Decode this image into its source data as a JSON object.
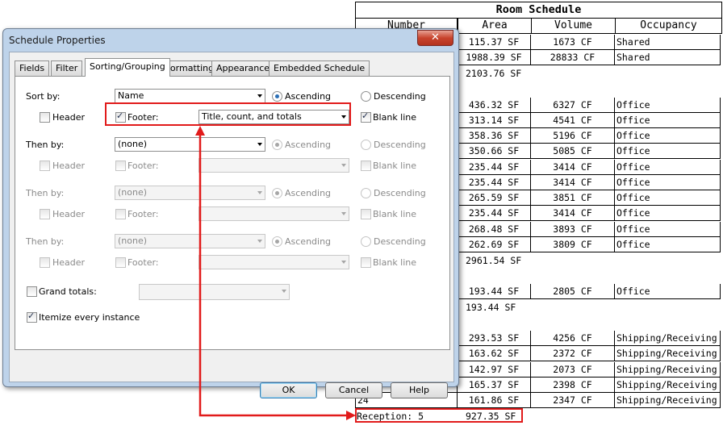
{
  "schedule": {
    "title": "Room Schedule",
    "headers": [
      "Number",
      "Area",
      "Volume",
      "Occupancy"
    ],
    "rows": [
      {
        "number": "",
        "area": "115.37 SF",
        "volume": "1673 CF",
        "occupancy": "Shared"
      },
      {
        "number": "",
        "area": "1988.39 SF",
        "volume": "28833 CF",
        "occupancy": "Shared"
      },
      {
        "number": "",
        "area": "436.32 SF",
        "volume": "6327 CF",
        "occupancy": "Office"
      },
      {
        "number": "",
        "area": "313.14 SF",
        "volume": "4541 CF",
        "occupancy": "Office"
      },
      {
        "number": "",
        "area": "358.36 SF",
        "volume": "5196 CF",
        "occupancy": "Office"
      },
      {
        "number": "",
        "area": "350.66 SF",
        "volume": "5085 CF",
        "occupancy": "Office"
      },
      {
        "number": "",
        "area": "235.44 SF",
        "volume": "3414 CF",
        "occupancy": "Office"
      },
      {
        "number": "",
        "area": "235.44 SF",
        "volume": "3414 CF",
        "occupancy": "Office"
      },
      {
        "number": "",
        "area": "265.59 SF",
        "volume": "3851 CF",
        "occupancy": "Office"
      },
      {
        "number": "",
        "area": "235.44 SF",
        "volume": "3414 CF",
        "occupancy": "Office"
      },
      {
        "number": "",
        "area": "268.48 SF",
        "volume": "3893 CF",
        "occupancy": "Office"
      },
      {
        "number": "",
        "area": "262.69 SF",
        "volume": "3809 CF",
        "occupancy": "Office"
      },
      {
        "number": "",
        "area": "193.44 SF",
        "volume": "2805 CF",
        "occupancy": "Office"
      },
      {
        "number": "",
        "area": "293.53 SF",
        "volume": "4256 CF",
        "occupancy": "Shipping/Receiving"
      },
      {
        "number": "",
        "area": "163.62 SF",
        "volume": "2372 CF",
        "occupancy": "Shipping/Receiving"
      },
      {
        "number": "",
        "area": "142.97 SF",
        "volume": "2073 CF",
        "occupancy": "Shipping/Receiving"
      },
      {
        "number": "",
        "area": "165.37 SF",
        "volume": "2398 CF",
        "occupancy": "Shipping/Receiving"
      },
      {
        "number": "24",
        "area": "161.86 SF",
        "volume": "2347 CF",
        "occupancy": "Shipping/Receiving"
      }
    ],
    "subtotals": [
      {
        "label": "",
        "area": "2103.76 SF"
      },
      {
        "label": "",
        "area": "2961.54 SF"
      },
      {
        "label": "",
        "area": "193.44 SF"
      },
      {
        "label": "Reception: 5",
        "area": "927.35 SF"
      }
    ]
  },
  "dialog": {
    "title": "Schedule Properties",
    "close_glyph": "✕",
    "tabs": [
      "Fields",
      "Filter",
      "Sorting/Grouping",
      "Formatting",
      "Appearance",
      "Embedded Schedule"
    ],
    "sort_by": {
      "label": "Sort by:",
      "field": "Name",
      "ascending": "Ascending",
      "descending": "Descending",
      "header": "Header",
      "footer": "Footer:",
      "footer_option": "Title, count, and totals",
      "blank_line": "Blank line"
    },
    "then_by": [
      {
        "label": "Then by:",
        "field": "(none)",
        "ascending": "Ascending",
        "descending": "Descending",
        "header": "Header",
        "footer": "Footer:",
        "blank_line": "Blank line"
      },
      {
        "label": "Then by:",
        "field": "(none)",
        "ascending": "Ascending",
        "descending": "Descending",
        "header": "Header",
        "footer": "Footer:",
        "blank_line": "Blank line"
      },
      {
        "label": "Then by:",
        "field": "(none)",
        "ascending": "Ascending",
        "descending": "Descending",
        "header": "Header",
        "footer": "Footer:",
        "blank_line": "Blank line"
      }
    ],
    "grand_totals": "Grand totals:",
    "itemize": "Itemize every instance",
    "buttons": {
      "ok": "OK",
      "cancel": "Cancel",
      "help": "Help"
    }
  },
  "colors": {
    "highlight": "#e11b1b",
    "dialog_frame": "#bed3ea"
  }
}
